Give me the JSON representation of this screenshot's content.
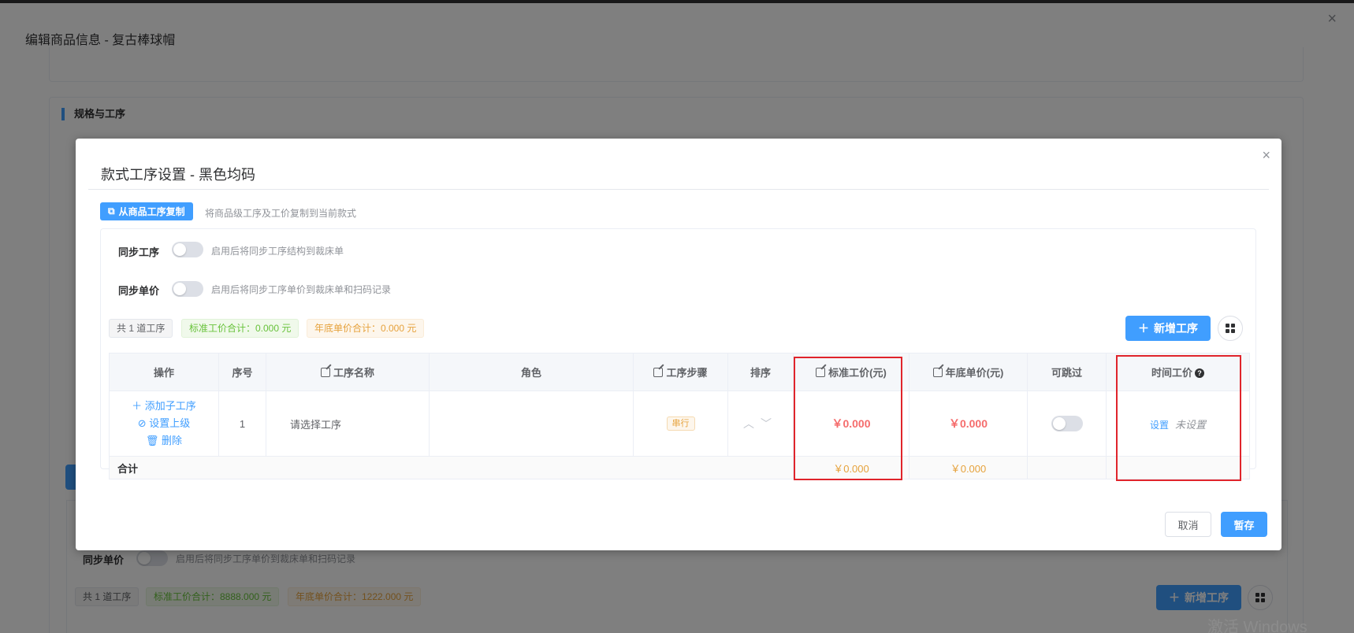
{
  "background": {
    "title": "编辑商品信息 - 复古棒球帽",
    "section_title": "规格与工序",
    "sync_price_label": "同步单价",
    "sync_price_hint": "启用后将同步工序单价到裁床单和扫码记录",
    "count_tag": "共 1 道工序",
    "std_total_tag": "标准工价合计：8888.000 元",
    "year_total_tag": "年底单价合计：1222.000 元",
    "add_button": "新增工序",
    "close_icon": "×"
  },
  "modal": {
    "title": "款式工序设置 - 黑色均码",
    "close_icon": "×",
    "copy_button": "从商品工序复制",
    "copy_hint": "将商品级工序及工价复制到当前款式",
    "sync_process_label": "同步工序",
    "sync_process_hint": "启用后将同步工序结构到裁床单",
    "sync_price_label": "同步单价",
    "sync_price_hint": "启用后将同步工序单价到裁床单和扫码记录",
    "count_tag": "共 1 道工序",
    "std_total_tag": "标准工价合计：0.000 元",
    "year_total_tag": "年底单价合计：0.000 元",
    "add_button": "新增工序",
    "table": {
      "headers": {
        "ops": "操作",
        "seq": "序号",
        "name": "工序名称",
        "role": "角色",
        "step": "工序步骤",
        "sort": "排序",
        "std_price": "标准工价(元)",
        "year_price": "年底单价(元)",
        "skippable": "可跳过",
        "time_price": "时间工价"
      },
      "row": {
        "op_add_child": "添加子工序",
        "op_set_parent": "设置上级",
        "op_delete": "删除",
        "seq": "1",
        "name": "请选择工序",
        "role": "",
        "step_tag": "串行",
        "std_price": "￥0.000",
        "year_price": "￥0.000",
        "time_set_link": "设置",
        "time_status": "未设置"
      },
      "footer": {
        "label": "合计",
        "std_total": "￥0.000",
        "year_total": "￥0.000"
      }
    },
    "cancel_button": "取消",
    "save_button": "暂存"
  },
  "watermark": "激活 Windows",
  "colors": {
    "primary": "#409eff",
    "price_red": "#f56c6c",
    "warning": "#e6a23c",
    "success": "#67c23a",
    "highlight_box": "#e0242b"
  }
}
